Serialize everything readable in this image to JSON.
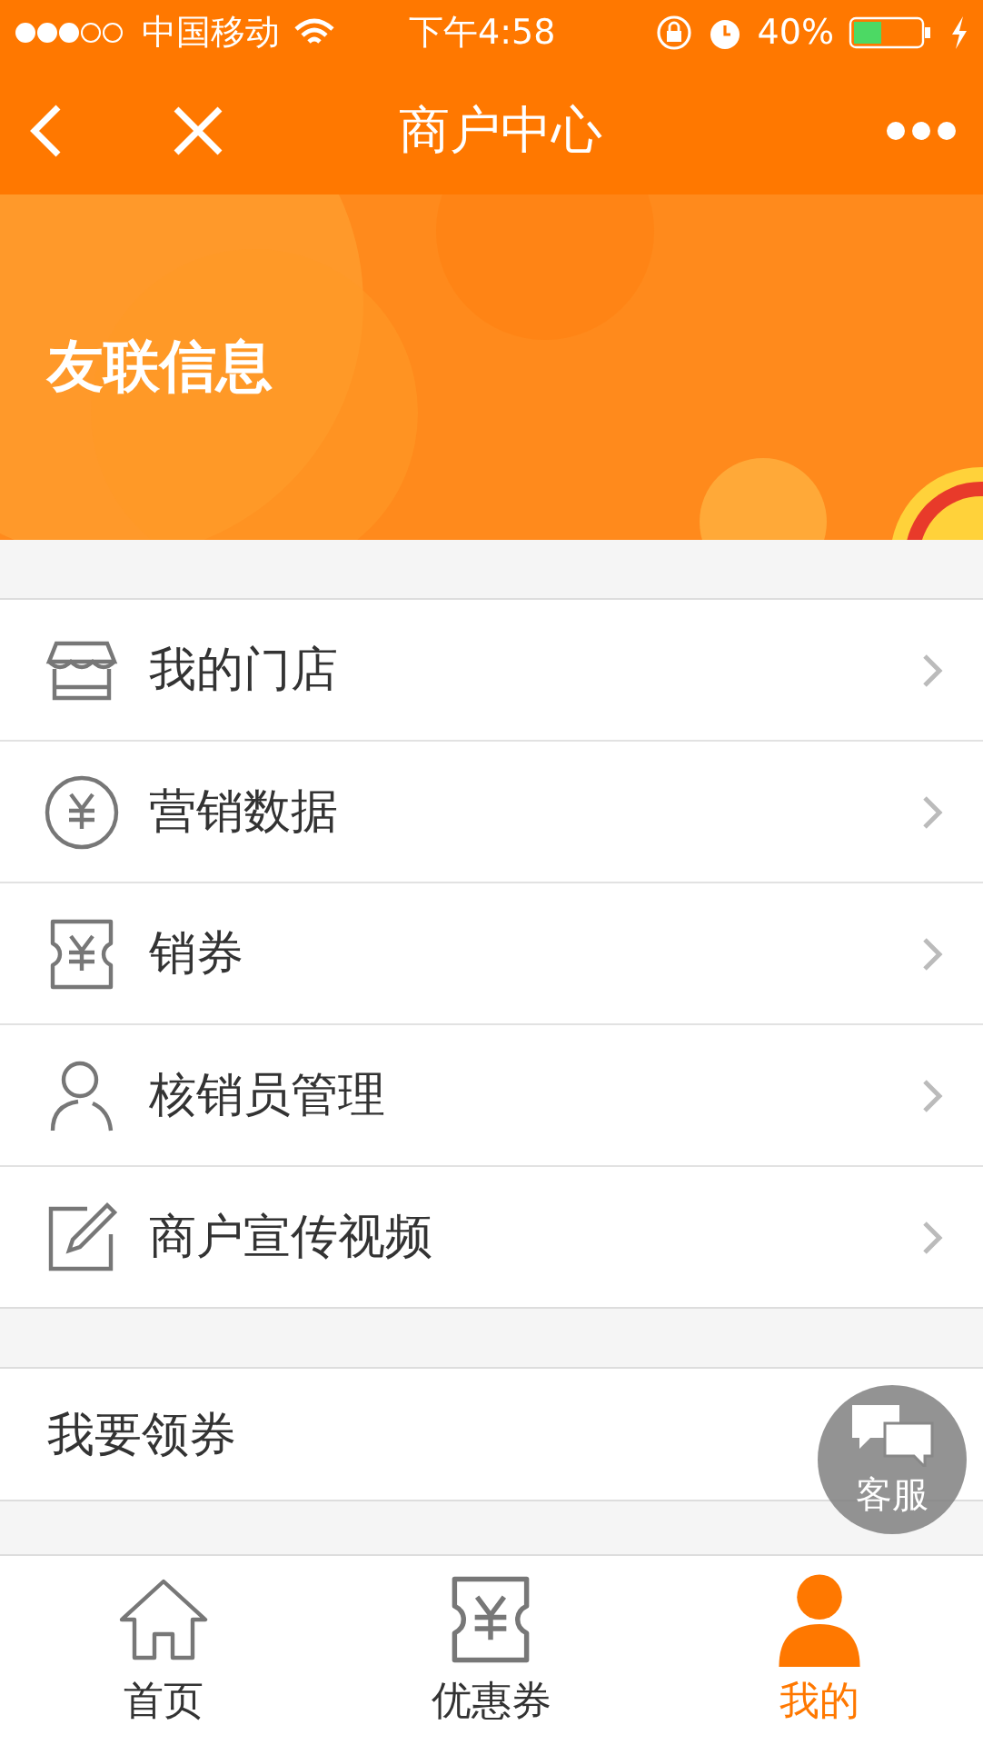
{
  "status_bar": {
    "carrier": "中国移动",
    "time": "下午4:58",
    "battery": "40%"
  },
  "nav": {
    "title": "商户中心"
  },
  "banner": {
    "title": "友联信息"
  },
  "menu": [
    {
      "kind": "store",
      "label": "我的门店"
    },
    {
      "kind": "yen",
      "label": "营销数据"
    },
    {
      "kind": "ticket",
      "label": "销券"
    },
    {
      "kind": "person",
      "label": "核销员管理"
    },
    {
      "kind": "edit",
      "label": "商户宣传视频"
    }
  ],
  "coupon_row": {
    "label": "我要领券"
  },
  "service_button": {
    "label": "客服"
  },
  "tabs": [
    {
      "kind": "home",
      "label": "首页",
      "selected": false
    },
    {
      "kind": "ticket",
      "label": "优惠券",
      "selected": false
    },
    {
      "kind": "person",
      "label": "我的",
      "selected": true
    }
  ]
}
